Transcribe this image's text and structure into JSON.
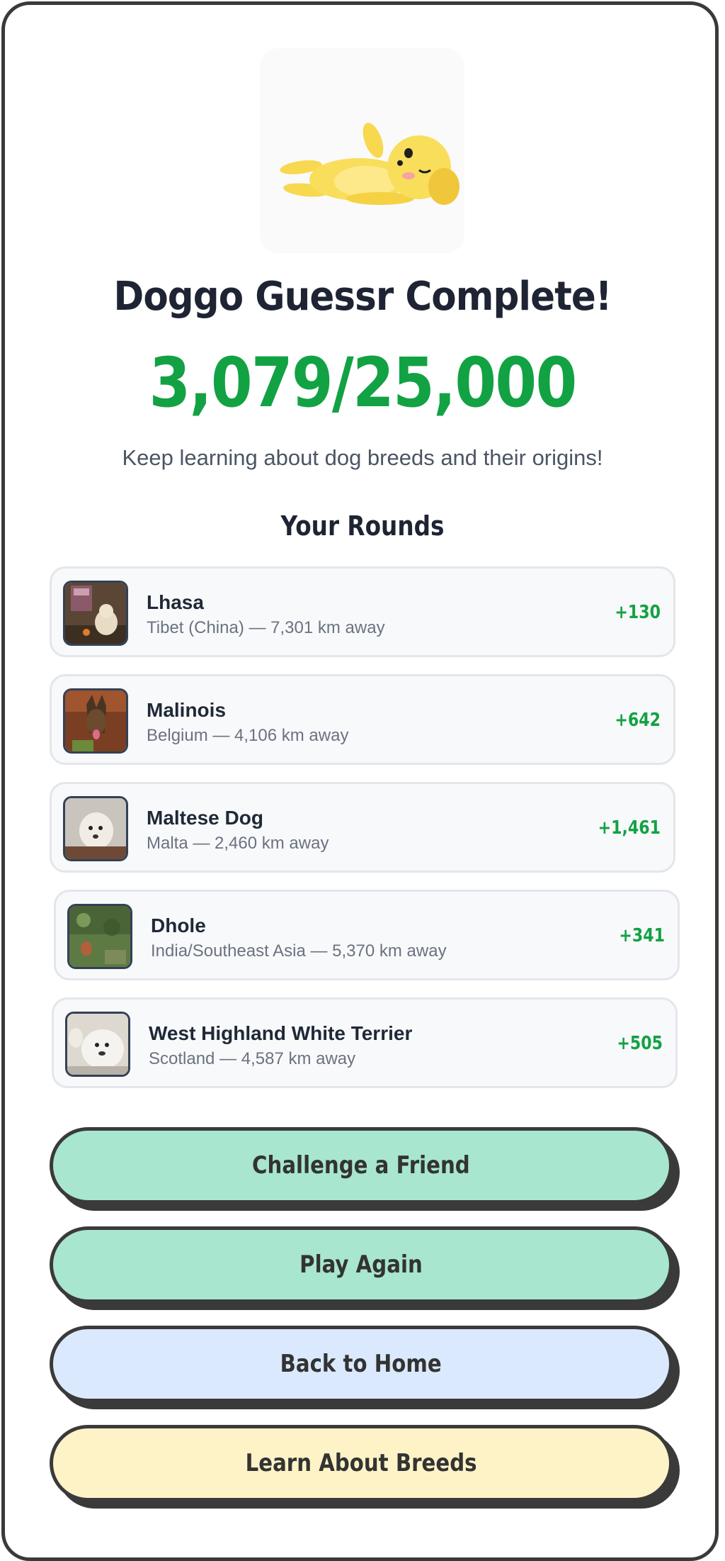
{
  "header": {
    "title": "Doggo Guessr Complete!",
    "score": "3,079/25,000",
    "tagline": "Keep learning about dog breeds and their origins!"
  },
  "rounds": {
    "heading": "Your Rounds",
    "items": [
      {
        "breed": "Lhasa",
        "meta": "Tibet (China) — 7,301 km away",
        "points": "+130"
      },
      {
        "breed": "Malinois",
        "meta": "Belgium — 4,106 km away",
        "points": "+642"
      },
      {
        "breed": "Maltese Dog",
        "meta": "Malta — 2,460 km away",
        "points": "+1,461"
      },
      {
        "breed": "Dhole",
        "meta": "India/Southeast Asia — 5,370 km away",
        "points": "+341"
      },
      {
        "breed": "West Highland White Terrier",
        "meta": "Scotland — 4,587 km away",
        "points": "+505"
      }
    ]
  },
  "actions": {
    "challenge": "Challenge a Friend",
    "play_again": "Play Again",
    "home": "Back to Home",
    "learn": "Learn About Breeds"
  },
  "colors": {
    "score_green": "#12a243",
    "challenge_bg": "#a8e6cf",
    "play_bg": "#a8e6cf",
    "home_bg": "#dbe9fe",
    "learn_bg": "#fef3c7",
    "border_dark": "#3a3a3a"
  },
  "icons": {
    "mascot": "sleeping-puppy-illustration"
  }
}
